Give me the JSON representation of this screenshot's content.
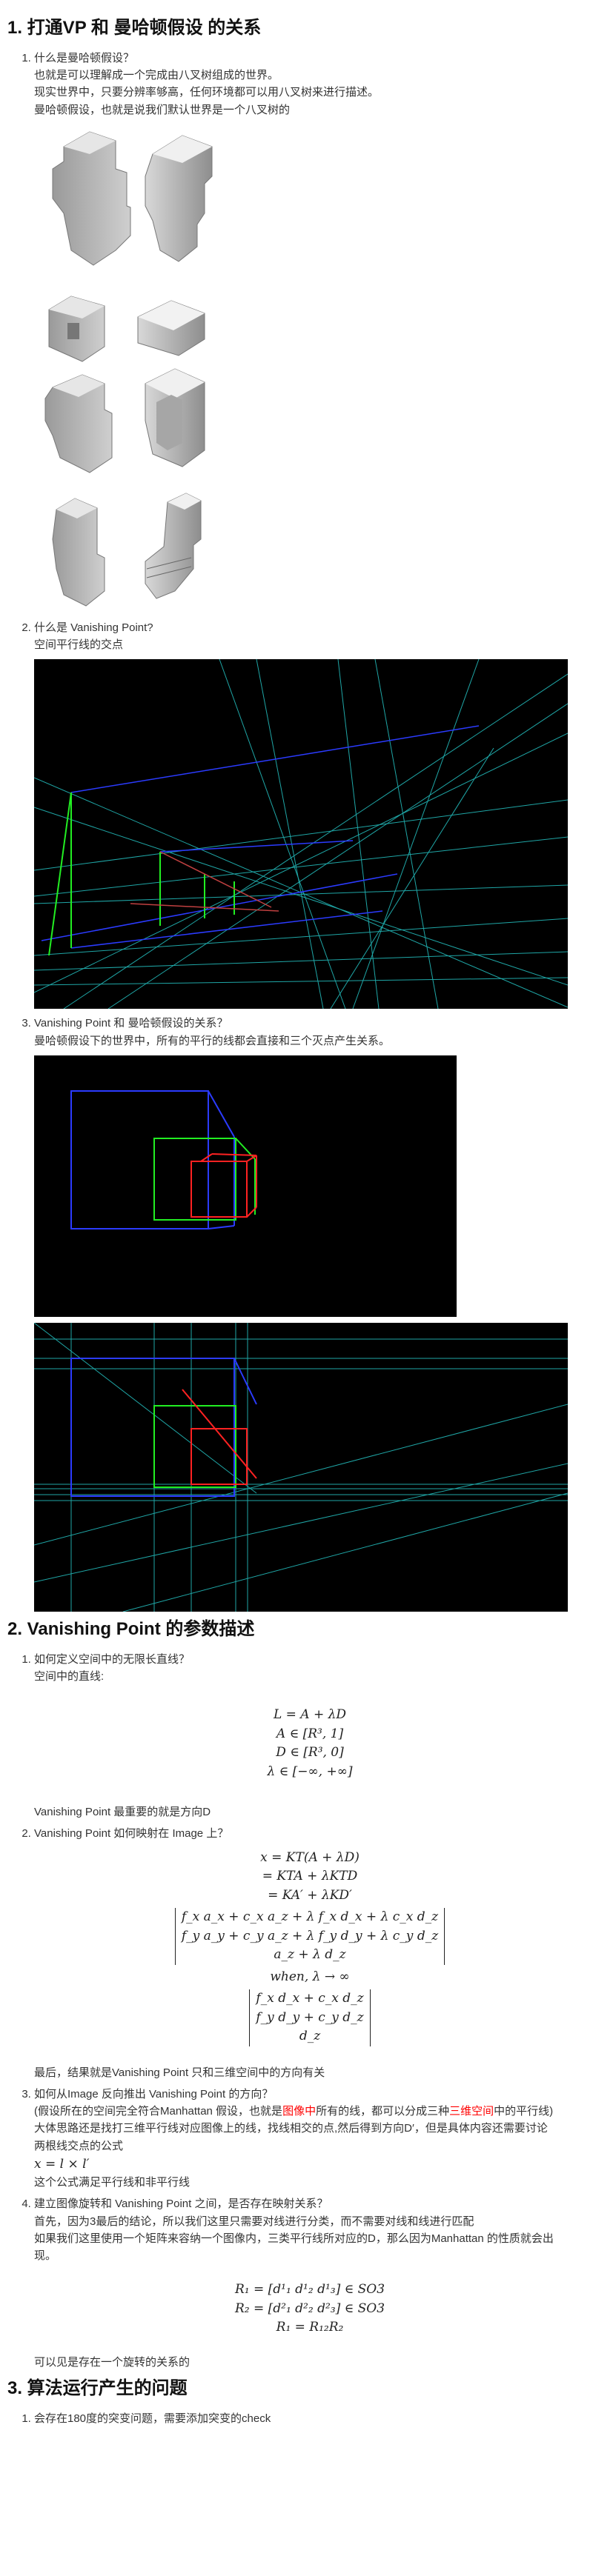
{
  "sections": [
    {
      "title": "1. 打通VP 和 曼哈顿假设 的关系",
      "items": [
        {
          "q": "什么是曼哈顿假设？",
          "lines": [
            "也就是可以理解成一个完成由八叉树组成的世界。",
            "现实世界中，只要分辨率够高，任何环境都可以用八叉树来进行描述。",
            "曼哈顿假设，也就是说我们默认世界是一个八叉树的"
          ]
        },
        {
          "q": "什么是 Vanishing Point?",
          "lines": [
            "空间平行线的交点"
          ]
        },
        {
          "q": "Vanishing Point 和 曼哈顿假设的关系？",
          "lines": [
            "曼哈顿假设下的世界中，所有的平行的线都会直接和三个灭点产生关系。"
          ]
        }
      ]
    },
    {
      "title": "2. Vanishing Point 的参数描述",
      "items": [
        {
          "q": "如何定义空间中的无限长直线？",
          "lines": [
            "空间中的直线:"
          ],
          "math": [
            "L = A + λD",
            "A ∈ [R³, 1]",
            "D ∈ [R³, 0]",
            "λ ∈ [−∞, +∞]"
          ],
          "after": [
            "Vanishing Point 最重要的就是方向D"
          ]
        },
        {
          "q": "Vanishing Point 如何映射在 Image 上？",
          "math": [
            "x = KT(A + λD)",
            "= KTA + λKTD",
            "= KA′ + λKD′"
          ],
          "matrix1": [
            "f_x a_x + c_x a_z + λ f_x d_x + λ c_x d_z",
            "f_y a_y + c_y a_z + λ f_y d_y + λ c_y d_z",
            "a_z + λ d_z"
          ],
          "when": "when, λ → ∞",
          "matrix2": [
            "f_x d_x + c_x d_z",
            "f_y d_y + c_y d_z",
            "d_z"
          ],
          "after": [
            "最后，结果就是Vanishing Point 只和三维空间中的方向有关"
          ]
        },
        {
          "q": "如何从Image 反向推出 Vanishing Point 的方向？",
          "p1_a": "(假设所在的空间完全符合Manhattan 假设，也就是",
          "p1_red1": "图像中",
          "p1_b": "所有的线，都可以分成三种",
          "p1_red2": "三维空间",
          "p1_c": "中的平行线)",
          "lines": [
            "大体思路还是找打三维平行线对应图像上的线，找线相交的点,然后得到方向D′，但是具体内容还需要讨论",
            "两根线交点的公式",
            "x = l × l′",
            "这个公式满足平行线和非平行线"
          ]
        },
        {
          "q": "建立图像旋转和 Vanishing Point 之间，是否存在映射关系？",
          "lines": [
            "首先，因为3最后的结论，所以我们这里只需要对线进行分类，而不需要对线和线进行匹配",
            "如果我们这里使用一个矩阵来容纳一个图像内，三类平行线所对应的D，那么因为Manhattan 的性质就会出",
            "现。"
          ],
          "math": [
            "R₁ = [d¹₁ d¹₂ d¹₃] ∈ SO3",
            "R₂ = [d²₁ d²₂ d²₃] ∈ SO3",
            "R₁ = R₁₂R₂"
          ],
          "after": [
            "可以见是存在一个旋转的关系的"
          ]
        }
      ]
    },
    {
      "title": "3. 算法运行产生的问题",
      "items": [
        {
          "q": "会存在180度的突变问题，需要添加突变的check"
        }
      ]
    }
  ]
}
